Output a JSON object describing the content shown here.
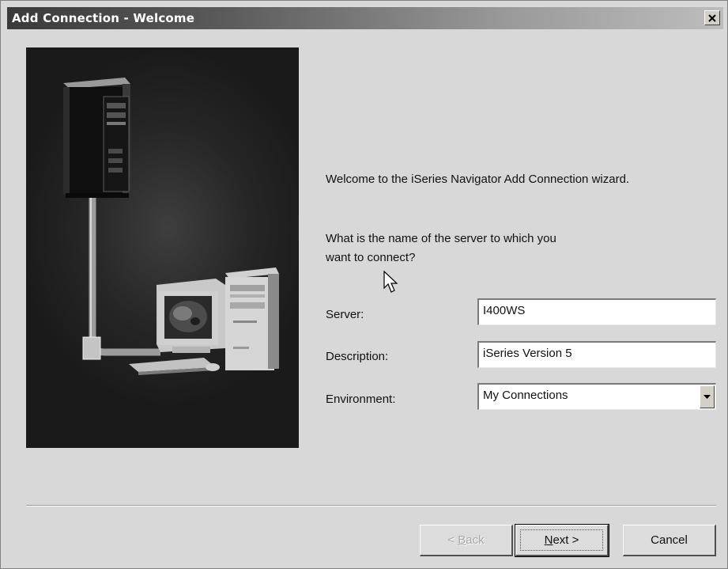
{
  "window": {
    "title": "Add Connection - Welcome",
    "close_glyph": "✕"
  },
  "illustration": {
    "icons": [
      "server-tower-icon",
      "desktop-pc-icon",
      "crt-monitor-icon",
      "keyboard-icon",
      "mouse-icon",
      "network-cable-icon"
    ]
  },
  "content": {
    "welcome_text": "Welcome to the iSeries Navigator Add Connection wizard.",
    "question_line1": "What is the name of the server to which you",
    "question_line2": "want to connect?"
  },
  "form": {
    "server_label": "Server:",
    "server_value": "I400WS",
    "description_label": "Description:",
    "description_value": "iSeries Version 5",
    "environment_label": "Environment:",
    "environment_value": "My Connections"
  },
  "buttons": {
    "back_prefix": "< ",
    "back_mnemonic": "B",
    "back_rest": "ack",
    "next_mnemonic": "N",
    "next_rest": "ext >",
    "cancel_label": "Cancel"
  },
  "colors": {
    "dialog_bg": "#d8d8d8",
    "title_text": "#ffffff",
    "panel_bg": "#262626"
  }
}
